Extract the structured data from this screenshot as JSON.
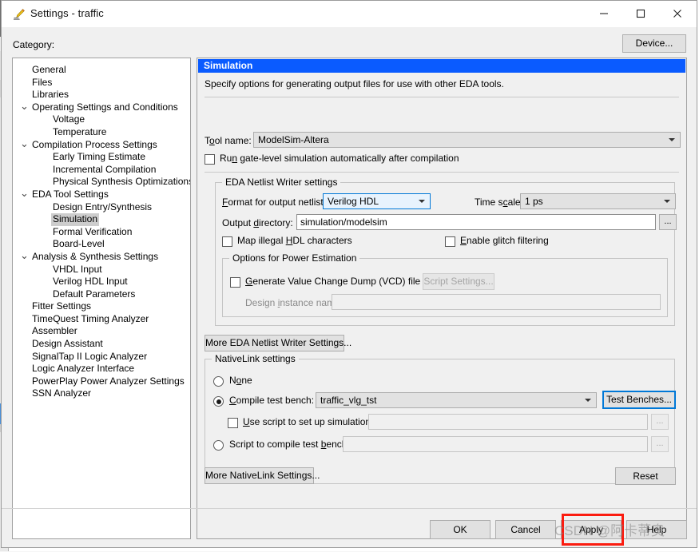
{
  "window": {
    "title": "Settings - traffic",
    "icon": "pencil-settings-icon",
    "minimize_label": "Minimize",
    "maximize_label": "Maximize",
    "close_label": "Close"
  },
  "category": {
    "label": "Category:",
    "device_button": "Device...",
    "selected": "Simulation",
    "items": [
      {
        "label": "General",
        "level": 0,
        "expandable": false
      },
      {
        "label": "Files",
        "level": 0,
        "expandable": false
      },
      {
        "label": "Libraries",
        "level": 0,
        "expandable": false
      },
      {
        "label": "Operating Settings and Conditions",
        "level": 0,
        "expandable": true
      },
      {
        "label": "Voltage",
        "level": 1,
        "expandable": false
      },
      {
        "label": "Temperature",
        "level": 1,
        "expandable": false
      },
      {
        "label": "Compilation Process Settings",
        "level": 0,
        "expandable": true
      },
      {
        "label": "Early Timing Estimate",
        "level": 1,
        "expandable": false
      },
      {
        "label": "Incremental Compilation",
        "level": 1,
        "expandable": false
      },
      {
        "label": "Physical Synthesis Optimizations",
        "level": 1,
        "expandable": false
      },
      {
        "label": "EDA Tool Settings",
        "level": 0,
        "expandable": true
      },
      {
        "label": "Design Entry/Synthesis",
        "level": 1,
        "expandable": false
      },
      {
        "label": "Simulation",
        "level": 1,
        "expandable": false,
        "selected": true
      },
      {
        "label": "Formal Verification",
        "level": 1,
        "expandable": false
      },
      {
        "label": "Board-Level",
        "level": 1,
        "expandable": false
      },
      {
        "label": "Analysis & Synthesis Settings",
        "level": 0,
        "expandable": true
      },
      {
        "label": "VHDL Input",
        "level": 1,
        "expandable": false
      },
      {
        "label": "Verilog HDL Input",
        "level": 1,
        "expandable": false
      },
      {
        "label": "Default Parameters",
        "level": 1,
        "expandable": false
      },
      {
        "label": "Fitter Settings",
        "level": 0,
        "expandable": false
      },
      {
        "label": "TimeQuest Timing Analyzer",
        "level": 0,
        "expandable": false
      },
      {
        "label": "Assembler",
        "level": 0,
        "expandable": false
      },
      {
        "label": "Design Assistant",
        "level": 0,
        "expandable": false
      },
      {
        "label": "SignalTap II Logic Analyzer",
        "level": 0,
        "expandable": false
      },
      {
        "label": "Logic Analyzer Interface",
        "level": 0,
        "expandable": false
      },
      {
        "label": "PowerPlay Power Analyzer Settings",
        "level": 0,
        "expandable": false
      },
      {
        "label": "SSN Analyzer",
        "level": 0,
        "expandable": false
      }
    ]
  },
  "panel": {
    "header": "Simulation",
    "description": "Specify options for generating output files for use with other EDA tools.",
    "tool_name_label": "Tool name:",
    "tool_name_value": "ModelSim-Altera",
    "run_gate_level_label": "Run gate-level simulation automatically after compilation",
    "run_gate_level_checked": false
  },
  "netlist_writer": {
    "group_title": "EDA Netlist Writer settings",
    "format_label": "Format for output netlist:",
    "format_value": "Verilog HDL",
    "time_scale_label": "Time scale:",
    "time_scale_value": "1 ps",
    "output_dir_label": "Output directory:",
    "output_dir_value": "simulation/modelsim",
    "browse_label": "...",
    "map_illegal_label": "Map illegal HDL characters",
    "map_illegal_checked": false,
    "enable_glitch_label": "Enable glitch filtering",
    "enable_glitch_checked": false,
    "power_group_title": "Options for Power Estimation",
    "generate_vcd_label": "Generate Value Change Dump (VCD) file script",
    "generate_vcd_checked": false,
    "script_settings_button": "Script Settings...",
    "design_instance_label": "Design instance name:",
    "design_instance_value": "",
    "more_settings_button": "More EDA Netlist Writer Settings..."
  },
  "nativelink": {
    "group_title": "NativeLink settings",
    "none_label": "None",
    "compile_test_bench_label": "Compile test bench:",
    "compile_test_bench_value": "traffic_vlg_tst",
    "test_benches_button": "Test Benches...",
    "use_script_label": "Use script to set up simulation:",
    "use_script_checked": false,
    "use_script_value": "",
    "script_compile_label": "Script to compile test bench:",
    "script_compile_value": "",
    "browse_label": "...",
    "selected_option": "compile-test-bench",
    "more_settings_button": "More NativeLink Settings...",
    "reset_button": "Reset"
  },
  "footer": {
    "ok": "OK",
    "cancel": "Cancel",
    "apply": "Apply",
    "help": "Help"
  },
  "annotation": {
    "highlight_target": "Apply",
    "highlight_color": "#fb1c10",
    "watermark": "CSDN @阿卡蒂奥"
  }
}
